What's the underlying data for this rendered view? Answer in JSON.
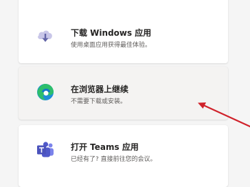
{
  "options": [
    {
      "icon": "cloud-download-icon",
      "title": "下载 Windows 应用",
      "subtitle": "使用桌面应用获得最佳体验。"
    },
    {
      "icon": "edge-browser-icon",
      "title": "在浏览器上继续",
      "subtitle": "不需要下载或安装。"
    },
    {
      "icon": "teams-logo-icon",
      "title": "打开 Teams 应用",
      "subtitle": "已经有了? 直接前往您的会议。"
    }
  ],
  "colors": {
    "annotation_arrow": "#d0222b",
    "cloud": "#c8c6e8",
    "download_arrow": "#6264a7",
    "teams": "#5059c9"
  }
}
